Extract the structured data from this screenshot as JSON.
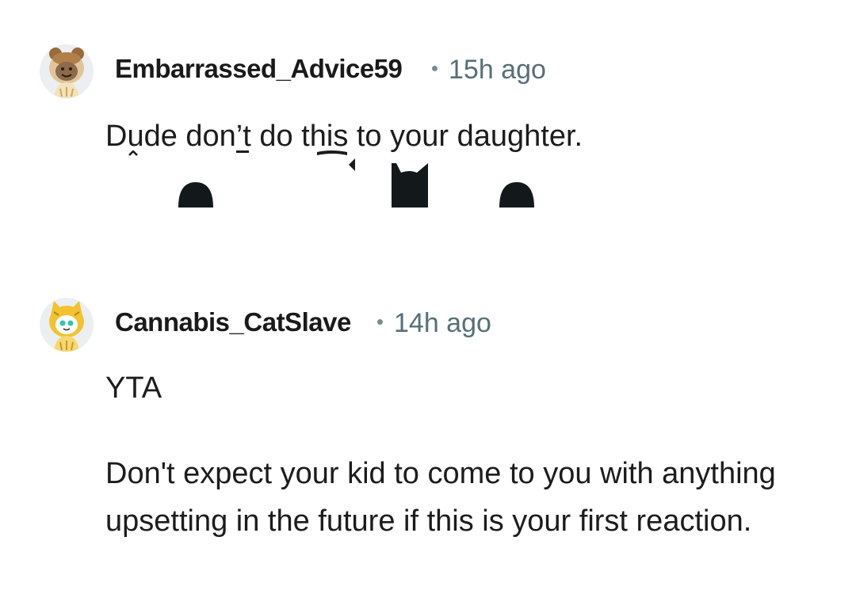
{
  "comments": [
    {
      "username": "Embarrassed_Advice59",
      "time": "15h ago",
      "avatar_icon": "bear-hood-snoo-avatar",
      "body": [
        "Dude don’t do this to your daughter."
      ]
    },
    {
      "username": "Cannabis_CatSlave",
      "time": "14h ago",
      "avatar_icon": "cat-hood-snoo-avatar",
      "body": [
        "YTA",
        "Don't expect your kid to come to you with anything upsetting in the future if this is your first reaction."
      ]
    }
  ],
  "colors": {
    "username": "#1a1a1b",
    "meta": "#576f76",
    "body": "#1c1c1c",
    "background": "#ffffff"
  }
}
